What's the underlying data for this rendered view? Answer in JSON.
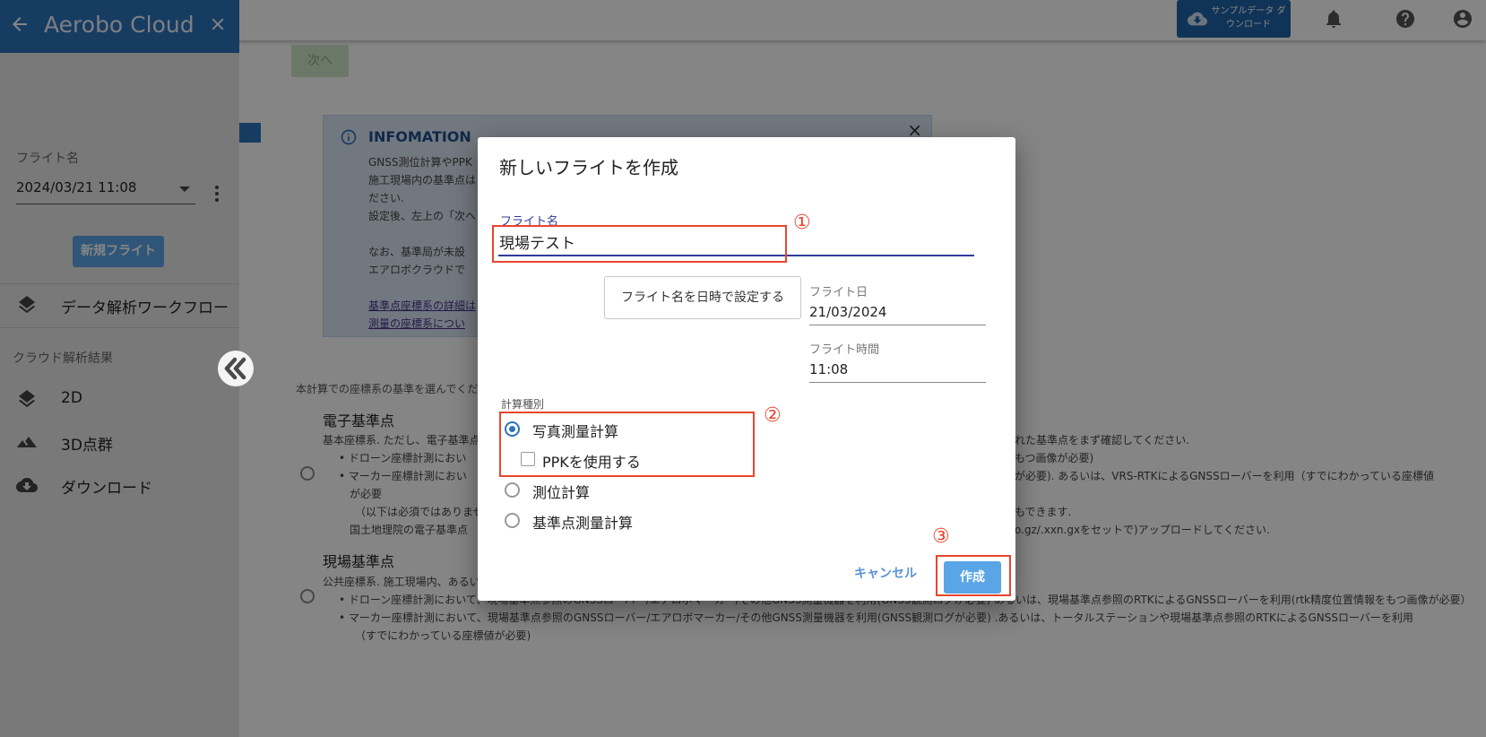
{
  "topbar": {
    "sample_download_label": "サンプルデータ ダウンロード",
    "icons": [
      "cloud-download-icon",
      "bell-icon",
      "help-icon",
      "account-icon"
    ]
  },
  "background": {
    "next_label": "次へ",
    "info": {
      "title": "INFOMATION",
      "lines": [
        "GNSS測位計算やPPK",
        "施工現場内の基準点は",
        "ださい.",
        "設定後、左上の「次へ",
        "",
        "なお、基準局が未設",
        "エアロボクラウドで"
      ],
      "link_lines": [
        "基準点座標系の詳細は",
        "測量の座標系につい"
      ]
    },
    "prompt": "本計算での座標系の基準を選んでくだ",
    "section1": {
      "title": "電子基準点",
      "lines": [
        "基本座標系. ただし、電子基準点",
        "• ドローン座標計測におい",
        "• マーカー座標計測におい",
        "が必要",
        "（以下は必須ではありませ",
        "国土地理院の電子基準点"
      ],
      "right_lines": [
        "れた基準点をまず確認してください.",
        "もつ画像が必要)",
        "が必要). あるいは、VRS-RTKによるGNSSローバーを利用（すでにわかっている座標値",
        "",
        "もできます.",
        "o.gz/.xxn.gxをセットで)アップロードしてください."
      ]
    },
    "section2": {
      "title": "現場基準点",
      "lines": [
        "公共座標系. 施工現場内、あるい",
        "• ドローン座標計測において、現場基準点参照のGNSSローバー/エアロボマーカー/その他GNSS測量機器を利用(GNSS観測ログが必要) あるいは、現場基準点参照のRTKによるGNSSローバーを利用(rtk精度位置情報をもつ画像が必要）",
        "• マーカー座標計測において、現場基準点参照のGNSSローバー/エアロボマーカー/その他GNSS測量機器を利用(GNSS観測ログが必要) .あるいは、トータルステーションや現場基準点参照のRTKによるGNSSローバーを利用",
        "（すでにわかっている座標値が必要)"
      ]
    }
  },
  "sidebar": {
    "title": "Aerobo Cloud",
    "flight_name_label": "フライト名",
    "flight_selected": "2024/03/21 11:08",
    "new_flight_label": "新規フライト",
    "workflow_label": "データ解析ワークフロー",
    "cloud_results_label": "クラウド解析結果",
    "items": [
      {
        "label": "2D",
        "icon": "layers-icon"
      },
      {
        "label": "3D点群",
        "icon": "terrain-icon"
      },
      {
        "label": "ダウンロード",
        "icon": "cloud-download-icon"
      }
    ]
  },
  "dialog": {
    "title": "新しいフライトを作成",
    "flight_name_label": "フライト名",
    "flight_name_value": "現場テスト",
    "set_name_button": "フライト名を日時で設定する",
    "flight_date_label": "フライト日",
    "flight_date_value": "21/03/2024",
    "flight_time_label": "フライト時間",
    "flight_time_value": "11:08",
    "calc_type_label": "計算種別",
    "options": [
      {
        "label": "写真測量計算",
        "selected": true
      },
      {
        "label": "測位計算",
        "selected": false
      },
      {
        "label": "基準点測量計算",
        "selected": false
      }
    ],
    "ppk_label": "PPKを使用する",
    "ppk_checked": false,
    "cancel_label": "キャンセル",
    "create_label": "作成"
  },
  "annotations": [
    "①",
    "②",
    "③"
  ],
  "colors": {
    "primary": "#2d74bd",
    "accent_button": "#5aa5e6",
    "annotation_red": "#e8452f",
    "input_underline": "#2f3b9a"
  }
}
